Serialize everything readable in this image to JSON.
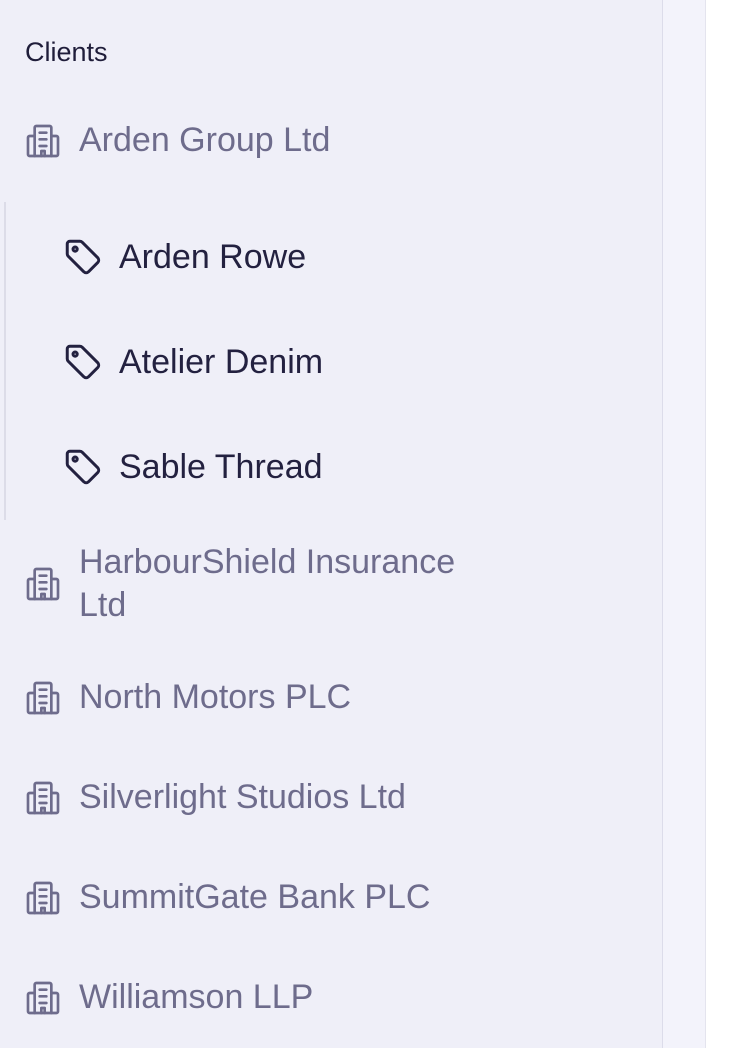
{
  "sidebar": {
    "section_title": "Clients",
    "clients": [
      {
        "label": "Arden Group Ltd",
        "icon": "building-icon"
      },
      {
        "label": "HarbourShield Insurance Ltd",
        "icon": "building-icon"
      },
      {
        "label": "North Motors PLC",
        "icon": "building-icon"
      },
      {
        "label": "Silverlight Studios Ltd",
        "icon": "building-icon"
      },
      {
        "label": "SummitGate Bank PLC",
        "icon": "building-icon"
      },
      {
        "label": "Williamson LLP",
        "icon": "building-icon"
      }
    ],
    "brands": [
      {
        "label": "Arden Rowe",
        "icon": "tag-icon"
      },
      {
        "label": "Atelier Denim",
        "icon": "tag-icon"
      },
      {
        "label": "Sable Thread",
        "icon": "tag-icon"
      }
    ]
  },
  "colors": {
    "sidebar_bg": "#efeff8",
    "client_text": "#6e6c8c",
    "brand_text": "#232140",
    "title_text": "#1f1d3a"
  }
}
